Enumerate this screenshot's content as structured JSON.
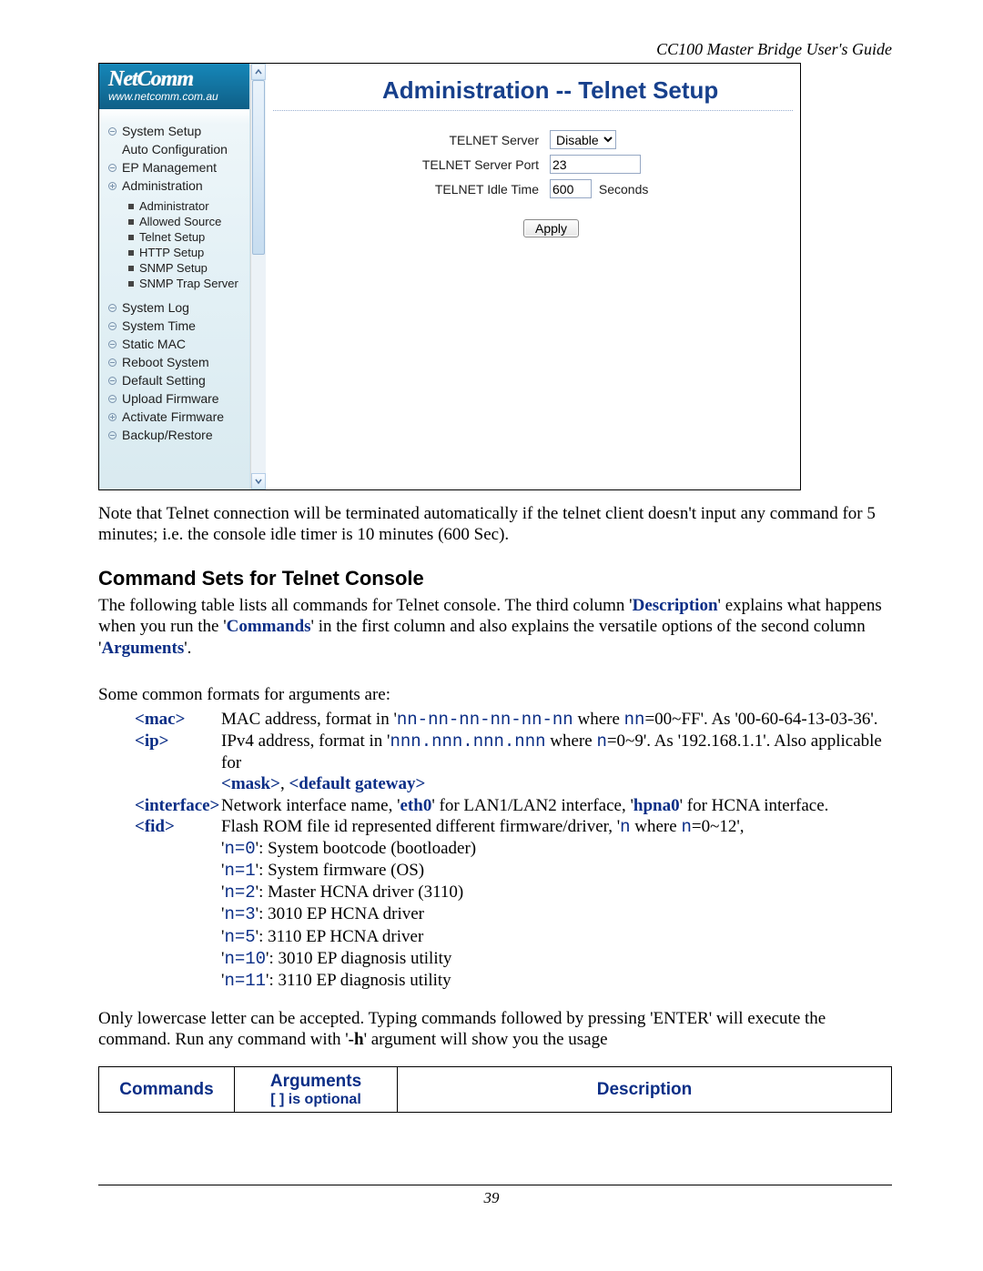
{
  "header": {
    "guide_title": "CC100 Master Bridge User's Guide"
  },
  "logo": {
    "brand": "NetComm",
    "url": "www.netcomm.com.au"
  },
  "nav": {
    "items": [
      {
        "label": "System Setup",
        "expand": "minus"
      },
      {
        "label": "Auto Configuration",
        "expand": "none"
      },
      {
        "label": "EP Management",
        "expand": "minus"
      },
      {
        "label": "Administration",
        "expand": "plus"
      },
      {
        "label": "System Log",
        "expand": "minus"
      },
      {
        "label": "System Time",
        "expand": "minus"
      },
      {
        "label": "Static MAC",
        "expand": "minus"
      },
      {
        "label": "Reboot System",
        "expand": "minus"
      },
      {
        "label": "Default Setting",
        "expand": "minus"
      },
      {
        "label": "Upload Firmware",
        "expand": "minus"
      },
      {
        "label": "Activate Firmware",
        "expand": "plus"
      },
      {
        "label": "Backup/Restore",
        "expand": "minus"
      }
    ],
    "admin_sub": [
      "Administrator",
      "Allowed Source",
      "Telnet Setup",
      "HTTP Setup",
      "SNMP Setup",
      "SNMP Trap Server"
    ]
  },
  "panel": {
    "title": "Administration -- Telnet Setup",
    "rows": {
      "server_label": "TELNET Server",
      "server_value": "Disable",
      "port_label": "TELNET Server Port",
      "port_value": "23",
      "idle_label": "TELNET Idle Time",
      "idle_value": "600",
      "idle_unit": "Seconds"
    },
    "apply": "Apply"
  },
  "note_text": "Note that Telnet connection will be terminated automatically if the telnet client doesn't input any command for 5 minutes; i.e. the console idle timer is 10 minutes (600 Sec).",
  "sec_heading": "Command Sets for Telnet Console",
  "sec_intro1a": "The following table lists all commands for Telnet console. The third column '",
  "sec_intro1b": "' explains what happens when you run the '",
  "sec_intro1c": "' in the first column and  also explains the versatile options of the second column '",
  "sec_intro1d": "'.",
  "kw_desc": "Description",
  "kw_cmds": "Commands",
  "kw_args": "Arguments",
  "formats_intro": "Some common formats for arguments are:",
  "args": {
    "mac": {
      "label": "<mac>",
      "text1": "MAC address, format in '",
      "mono": "nn-nn-nn-nn-nn-nn",
      "text2": " where ",
      "mono2": "nn",
      "text3": "=00~FF'. As '00-60-64-13-03-36'."
    },
    "ip": {
      "label": "<ip>",
      "text1": "IPv4 address, format in '",
      "mono": "nnn.nnn.nnn.nnn",
      "text2": " where ",
      "mono2": "n",
      "text3": "=0~9'. As '192.168.1.1'. Also applicable for ",
      "link1": "<mask>",
      "sep": ", ",
      "link2": "<default gateway>"
    },
    "iface": {
      "label": "<interface>",
      "text1": "Network interface name, '",
      "kw1": "eth0",
      "text2": "' for LAN1/LAN2 interface, '",
      "kw2": "hpna0",
      "text3": "' for HCNA interface."
    },
    "fid": {
      "label": "<fid>",
      "lead": "Flash ROM file id represented different firmware/driver, '",
      "mono": "n",
      "lead2": " where ",
      "mono2": "n",
      "lead3": "=0~12',",
      "lines": [
        {
          "code": "n=0",
          "rest": "': System bootcode (bootloader)"
        },
        {
          "code": "n=1",
          "rest": "': System firmware (OS)"
        },
        {
          "code": "n=2",
          "rest": "': Master HCNA driver (3110)"
        },
        {
          "code": "n=3",
          "rest": "': 3010 EP HCNA driver"
        },
        {
          "code": "n=5",
          "rest": "': 3110 EP HCNA driver"
        },
        {
          "code": "n=10",
          "rest": "': 3010 EP diagnosis utility"
        },
        {
          "code": "n=11",
          "rest": "': 3110 EP diagnosis utility"
        }
      ]
    }
  },
  "closing1": "Only lowercase letter can be accepted. Typing commands followed by pressing 'ENTER' will execute the command. Run any command with '",
  "closing_kw": "-h",
  "closing2": "' argument will show you the usage",
  "table": {
    "h1": "Commands",
    "h2": "Arguments",
    "h2sub": "[ ] is optional",
    "h3": "Description"
  },
  "page_number": "39"
}
